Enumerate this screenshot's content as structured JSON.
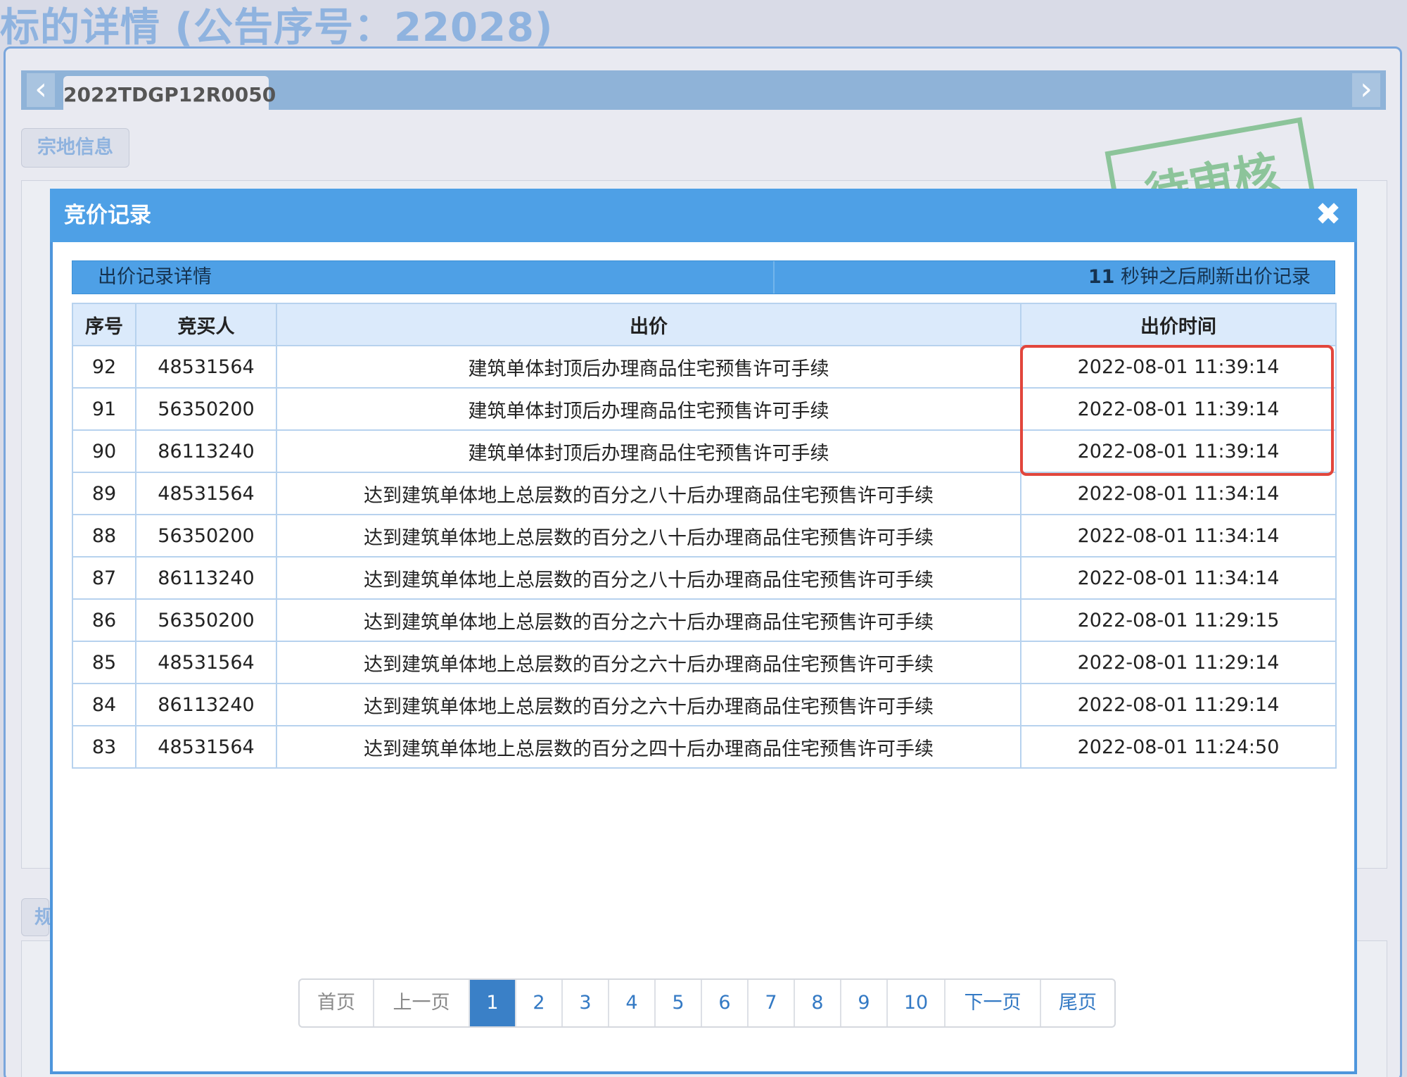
{
  "page": {
    "title": "标的详情 (公告序号：22028)",
    "tab_label": "2022TDGP12R0050",
    "subtab_label": "宗地信息",
    "partial_subtab_label": "规",
    "stamp_text": "待审核"
  },
  "modal": {
    "title": "竞价记录",
    "close_glyph": "✖",
    "records_heading": "出价记录详情",
    "refresh_seconds": "11",
    "refresh_text": " 秒钟之后刷新出价记录"
  },
  "table": {
    "headers": [
      "序号",
      "竞买人",
      "出价",
      "出价时间"
    ],
    "rows": [
      {
        "no": "92",
        "bidder": "48531564",
        "bid": "建筑单体封顶后办理商品住宅预售许可手续",
        "time": "2022-08-01 11:39:14"
      },
      {
        "no": "91",
        "bidder": "56350200",
        "bid": "建筑单体封顶后办理商品住宅预售许可手续",
        "time": "2022-08-01 11:39:14"
      },
      {
        "no": "90",
        "bidder": "86113240",
        "bid": "建筑单体封顶后办理商品住宅预售许可手续",
        "time": "2022-08-01 11:39:14"
      },
      {
        "no": "89",
        "bidder": "48531564",
        "bid": "达到建筑单体地上总层数的百分之八十后办理商品住宅预售许可手续",
        "time": "2022-08-01 11:34:14"
      },
      {
        "no": "88",
        "bidder": "56350200",
        "bid": "达到建筑单体地上总层数的百分之八十后办理商品住宅预售许可手续",
        "time": "2022-08-01 11:34:14"
      },
      {
        "no": "87",
        "bidder": "86113240",
        "bid": "达到建筑单体地上总层数的百分之八十后办理商品住宅预售许可手续",
        "time": "2022-08-01 11:34:14"
      },
      {
        "no": "86",
        "bidder": "56350200",
        "bid": "达到建筑单体地上总层数的百分之六十后办理商品住宅预售许可手续",
        "time": "2022-08-01 11:29:15"
      },
      {
        "no": "85",
        "bidder": "48531564",
        "bid": "达到建筑单体地上总层数的百分之六十后办理商品住宅预售许可手续",
        "time": "2022-08-01 11:29:14"
      },
      {
        "no": "84",
        "bidder": "86113240",
        "bid": "达到建筑单体地上总层数的百分之六十后办理商品住宅预售许可手续",
        "time": "2022-08-01 11:29:14"
      },
      {
        "no": "83",
        "bidder": "48531564",
        "bid": "达到建筑单体地上总层数的百分之四十后办理商品住宅预售许可手续",
        "time": "2022-08-01 11:24:50"
      }
    ]
  },
  "pagination": {
    "first": "首页",
    "prev": "上一页",
    "pages": [
      "1",
      "2",
      "3",
      "4",
      "5",
      "6",
      "7",
      "8",
      "9",
      "10"
    ],
    "current": "1",
    "next": "下一页",
    "last": "尾页"
  },
  "colors": {
    "header_blue": "#4ea0e6",
    "active_page": "#3a80c7",
    "highlight_red": "#e2463c"
  }
}
